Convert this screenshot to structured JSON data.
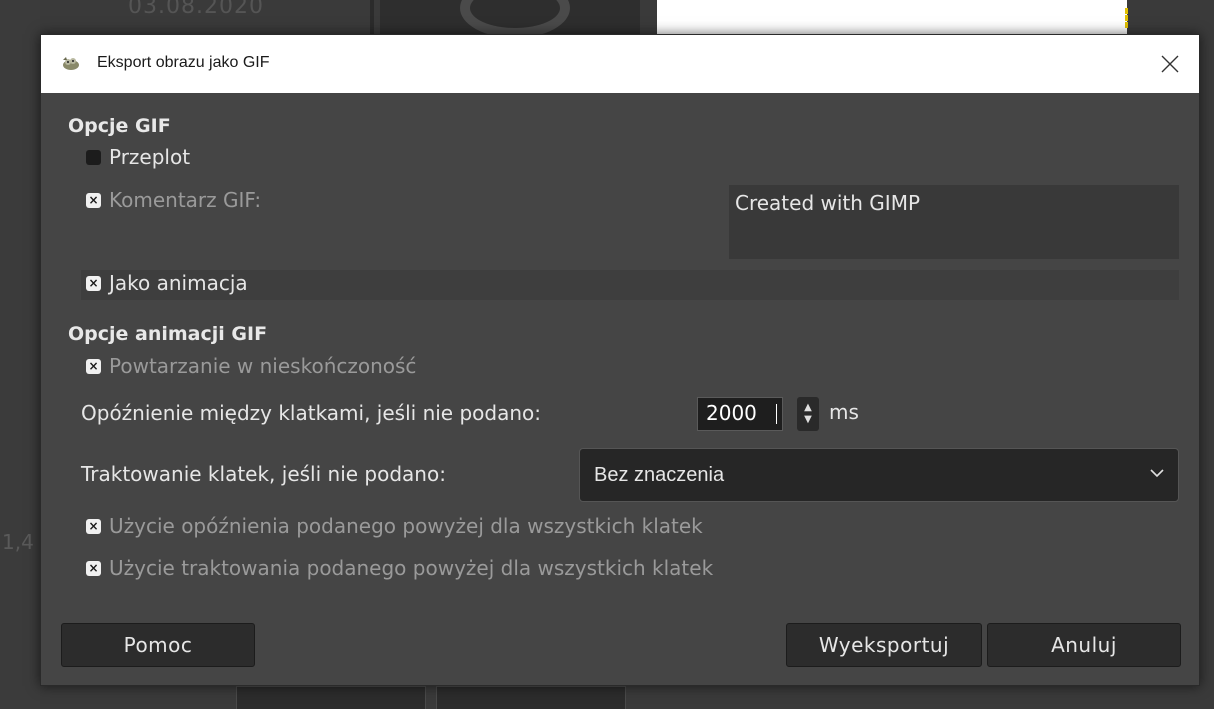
{
  "background": {
    "date_text": "03.08.2020",
    "side_text": "1,4"
  },
  "dialog": {
    "title": "Eksport obrazu jako GIF",
    "close_glyph": "✕",
    "gif_options": {
      "heading": "Opcje GIF",
      "interlace_label": "Przeplot",
      "interlace_checked": false,
      "comment_label": "Komentarz GIF:",
      "comment_checked": true,
      "comment_value": "Created with GIMP",
      "as_animation_label": "Jako animacja",
      "as_animation_checked": true
    },
    "animation_options": {
      "heading": "Opcje animacji GIF",
      "loop_label": "Powtarzanie w nieskończoność",
      "loop_checked": true,
      "delay_label": "Opóźnienie między klatkami, jeśli nie podano:",
      "delay_value": "2000",
      "delay_unit": "ms",
      "disposal_label": "Traktowanie klatek, jeśli nie podano:",
      "disposal_value": "Bez znaczenia",
      "use_delay_all_label": "Użycie opóźnienia podanego powyżej dla wszystkich klatek",
      "use_delay_all_checked": true,
      "use_disposal_all_label": "Użycie traktowania podanego powyżej dla wszystkich klatek",
      "use_disposal_all_checked": true
    },
    "buttons": {
      "help": "Pomoc",
      "export": "Wyeksportuj",
      "cancel": "Anuluj"
    }
  },
  "icons": {
    "title_icon": "gimp-wilber-icon",
    "close": "close-icon",
    "combo_arrow": "chevron-down-icon",
    "spin": "spin-arrows-icon",
    "check_mark": "×"
  }
}
